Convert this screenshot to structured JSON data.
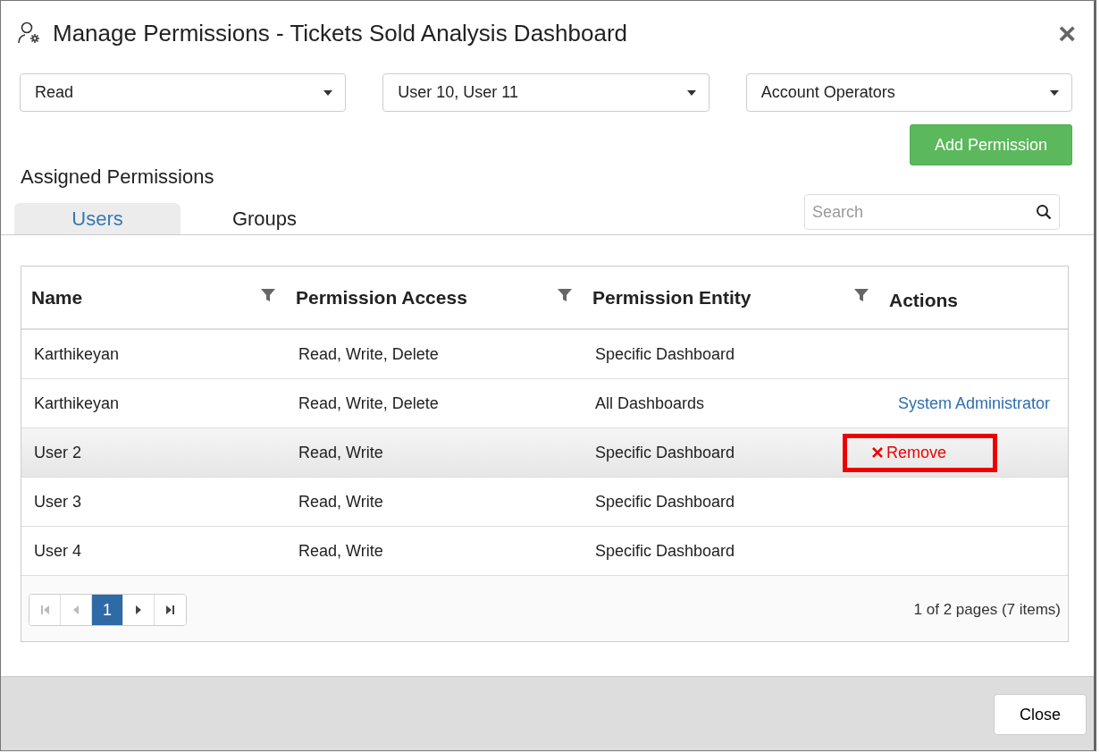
{
  "window": {
    "title": "Manage Permissions - Tickets Sold Analysis Dashboard",
    "close": "×"
  },
  "selects": [
    {
      "value": "Read"
    },
    {
      "value": "User 10, User 11"
    },
    {
      "value": "Account Operators"
    }
  ],
  "add_button": "Add Permission",
  "section_title": "Assigned Permissions",
  "tabs": [
    {
      "label": "Users",
      "selected": true
    },
    {
      "label": "Groups",
      "selected": false
    }
  ],
  "search": {
    "placeholder": "Search"
  },
  "table": {
    "columns": [
      {
        "label": "Name",
        "filter": true
      },
      {
        "label": "Permission Access",
        "filter": true
      },
      {
        "label": "Permission Entity",
        "filter": true
      },
      {
        "label": "Actions",
        "filter": false
      }
    ],
    "rows": [
      {
        "name": "Karthikeyan",
        "access": "Read, Write, Delete",
        "entity": "Specific Dashboard",
        "highlighted": false
      },
      {
        "name": "Karthikeyan",
        "access": "Read, Write, Delete",
        "entity": "All Dashboards",
        "highlighted": false,
        "action": {
          "kind": "link",
          "label": "System Administrator"
        }
      },
      {
        "name": "User 2",
        "access": "Read, Write",
        "entity": "Specific Dashboard",
        "highlighted": true,
        "action": {
          "kind": "remove",
          "label": "Remove",
          "annotated": true
        }
      },
      {
        "name": "User 3",
        "access": "Read, Write",
        "entity": "Specific Dashboard",
        "highlighted": false
      },
      {
        "name": "User 4",
        "access": "Read, Write",
        "entity": "Specific Dashboard",
        "highlighted": false
      }
    ]
  },
  "pager": {
    "pages": [
      {
        "label": "1",
        "selected": true
      }
    ],
    "info": "1 of 2 pages (7 items)"
  },
  "close_button": "Close"
}
